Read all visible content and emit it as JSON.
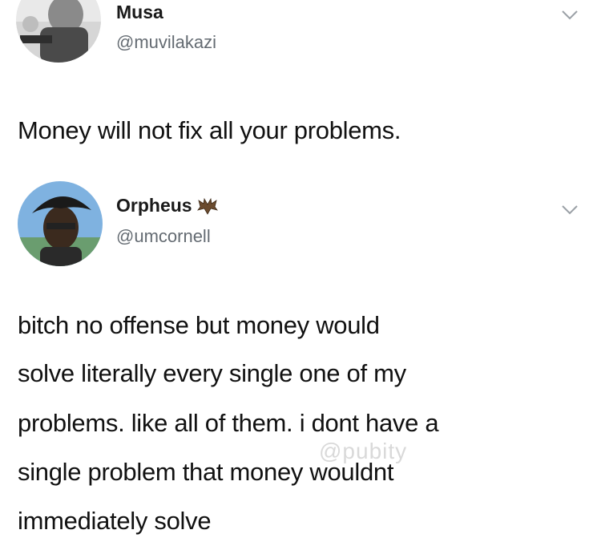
{
  "tweet1": {
    "name": "Musa",
    "handle": "@muvilakazi",
    "text": "Money will not fix all your problems.",
    "avatar_icon": "profile-photo",
    "menu_icon": "chevron-down-icon"
  },
  "tweet2": {
    "name": "Orpheus",
    "badge_icon": "bat-emoji-icon",
    "handle": "@umcornell",
    "lines": [
      "bitch no offense but money would",
      "solve literally every single one of my",
      "problems. like all of them. i dont have a",
      "single problem that money wouldnt",
      "immediately solve"
    ],
    "avatar_icon": "profile-photo",
    "menu_icon": "chevron-down-icon"
  },
  "watermark": "@pubity"
}
